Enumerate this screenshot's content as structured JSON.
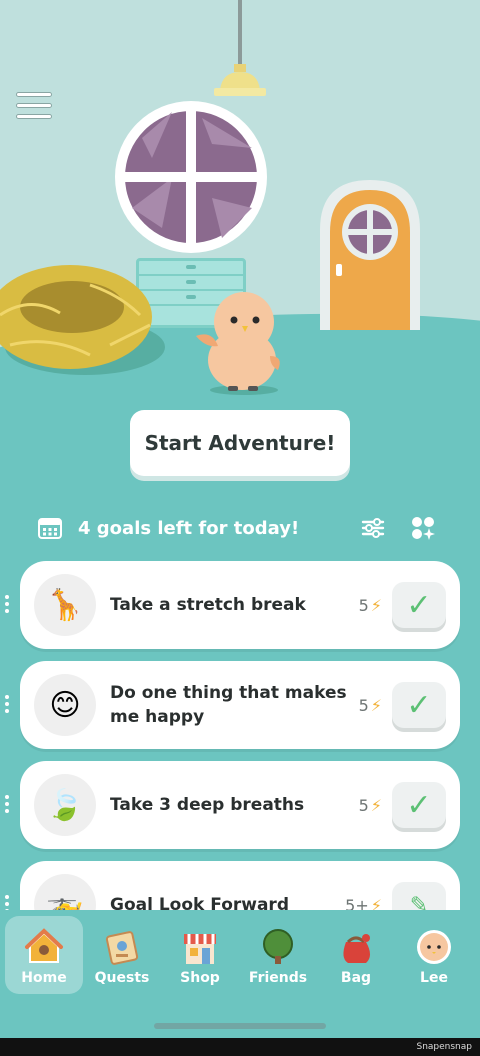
{
  "scene": {
    "start_button_label": "Start Adventure!"
  },
  "goals_header": {
    "title": "4 goals left for today!"
  },
  "goals": [
    {
      "emoji": "🦒",
      "text": "Take a stretch break",
      "points": "5",
      "icon": "giraffe-icon"
    },
    {
      "emoji": "😊",
      "text": "Do one thing that makes me happy",
      "points": "5",
      "icon": "smile-icon"
    },
    {
      "emoji": "🍃",
      "text": "Take 3 deep breaths",
      "points": "5",
      "icon": "leaf-icon"
    },
    {
      "emoji": "🚁",
      "text": "Goal Look Forward",
      "points": "5+",
      "icon": "helicopter-icon"
    }
  ],
  "nav": [
    {
      "label": "Home",
      "icon": "home-icon",
      "active": true
    },
    {
      "label": "Quests",
      "icon": "quests-icon"
    },
    {
      "label": "Shop",
      "icon": "shop-icon"
    },
    {
      "label": "Friends",
      "icon": "friends-icon"
    },
    {
      "label": "Bag",
      "icon": "bag-icon"
    },
    {
      "label": "Lee",
      "icon": "avatar-icon"
    }
  ],
  "watermark": "Snapensnap",
  "colors": {
    "teal": "#6cc5c0",
    "wall": "#bfe0dd",
    "bolt": "#f2b23a",
    "check": "#5cc074"
  }
}
